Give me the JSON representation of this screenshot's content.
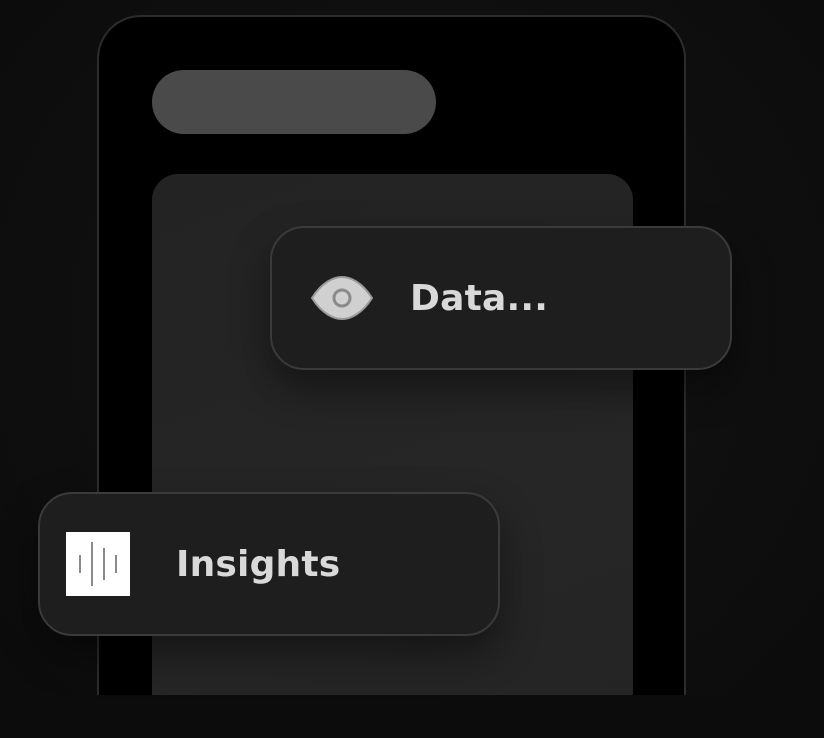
{
  "cards": {
    "data": {
      "label": "Data...",
      "icon": "eye-icon"
    },
    "insights": {
      "label": "Insights",
      "icon": "waveform-icon"
    }
  },
  "colors": {
    "background": "#0e0e0e",
    "frame": "#000000",
    "frame_border": "#2c2c2c",
    "header_pill": "#4a4a4a",
    "content_card": "#242424",
    "chip_background": "#1e1e1e",
    "chip_border": "#3a3a3a",
    "label_text": "#d9d9d9",
    "icon_tile": "#ffffff"
  }
}
